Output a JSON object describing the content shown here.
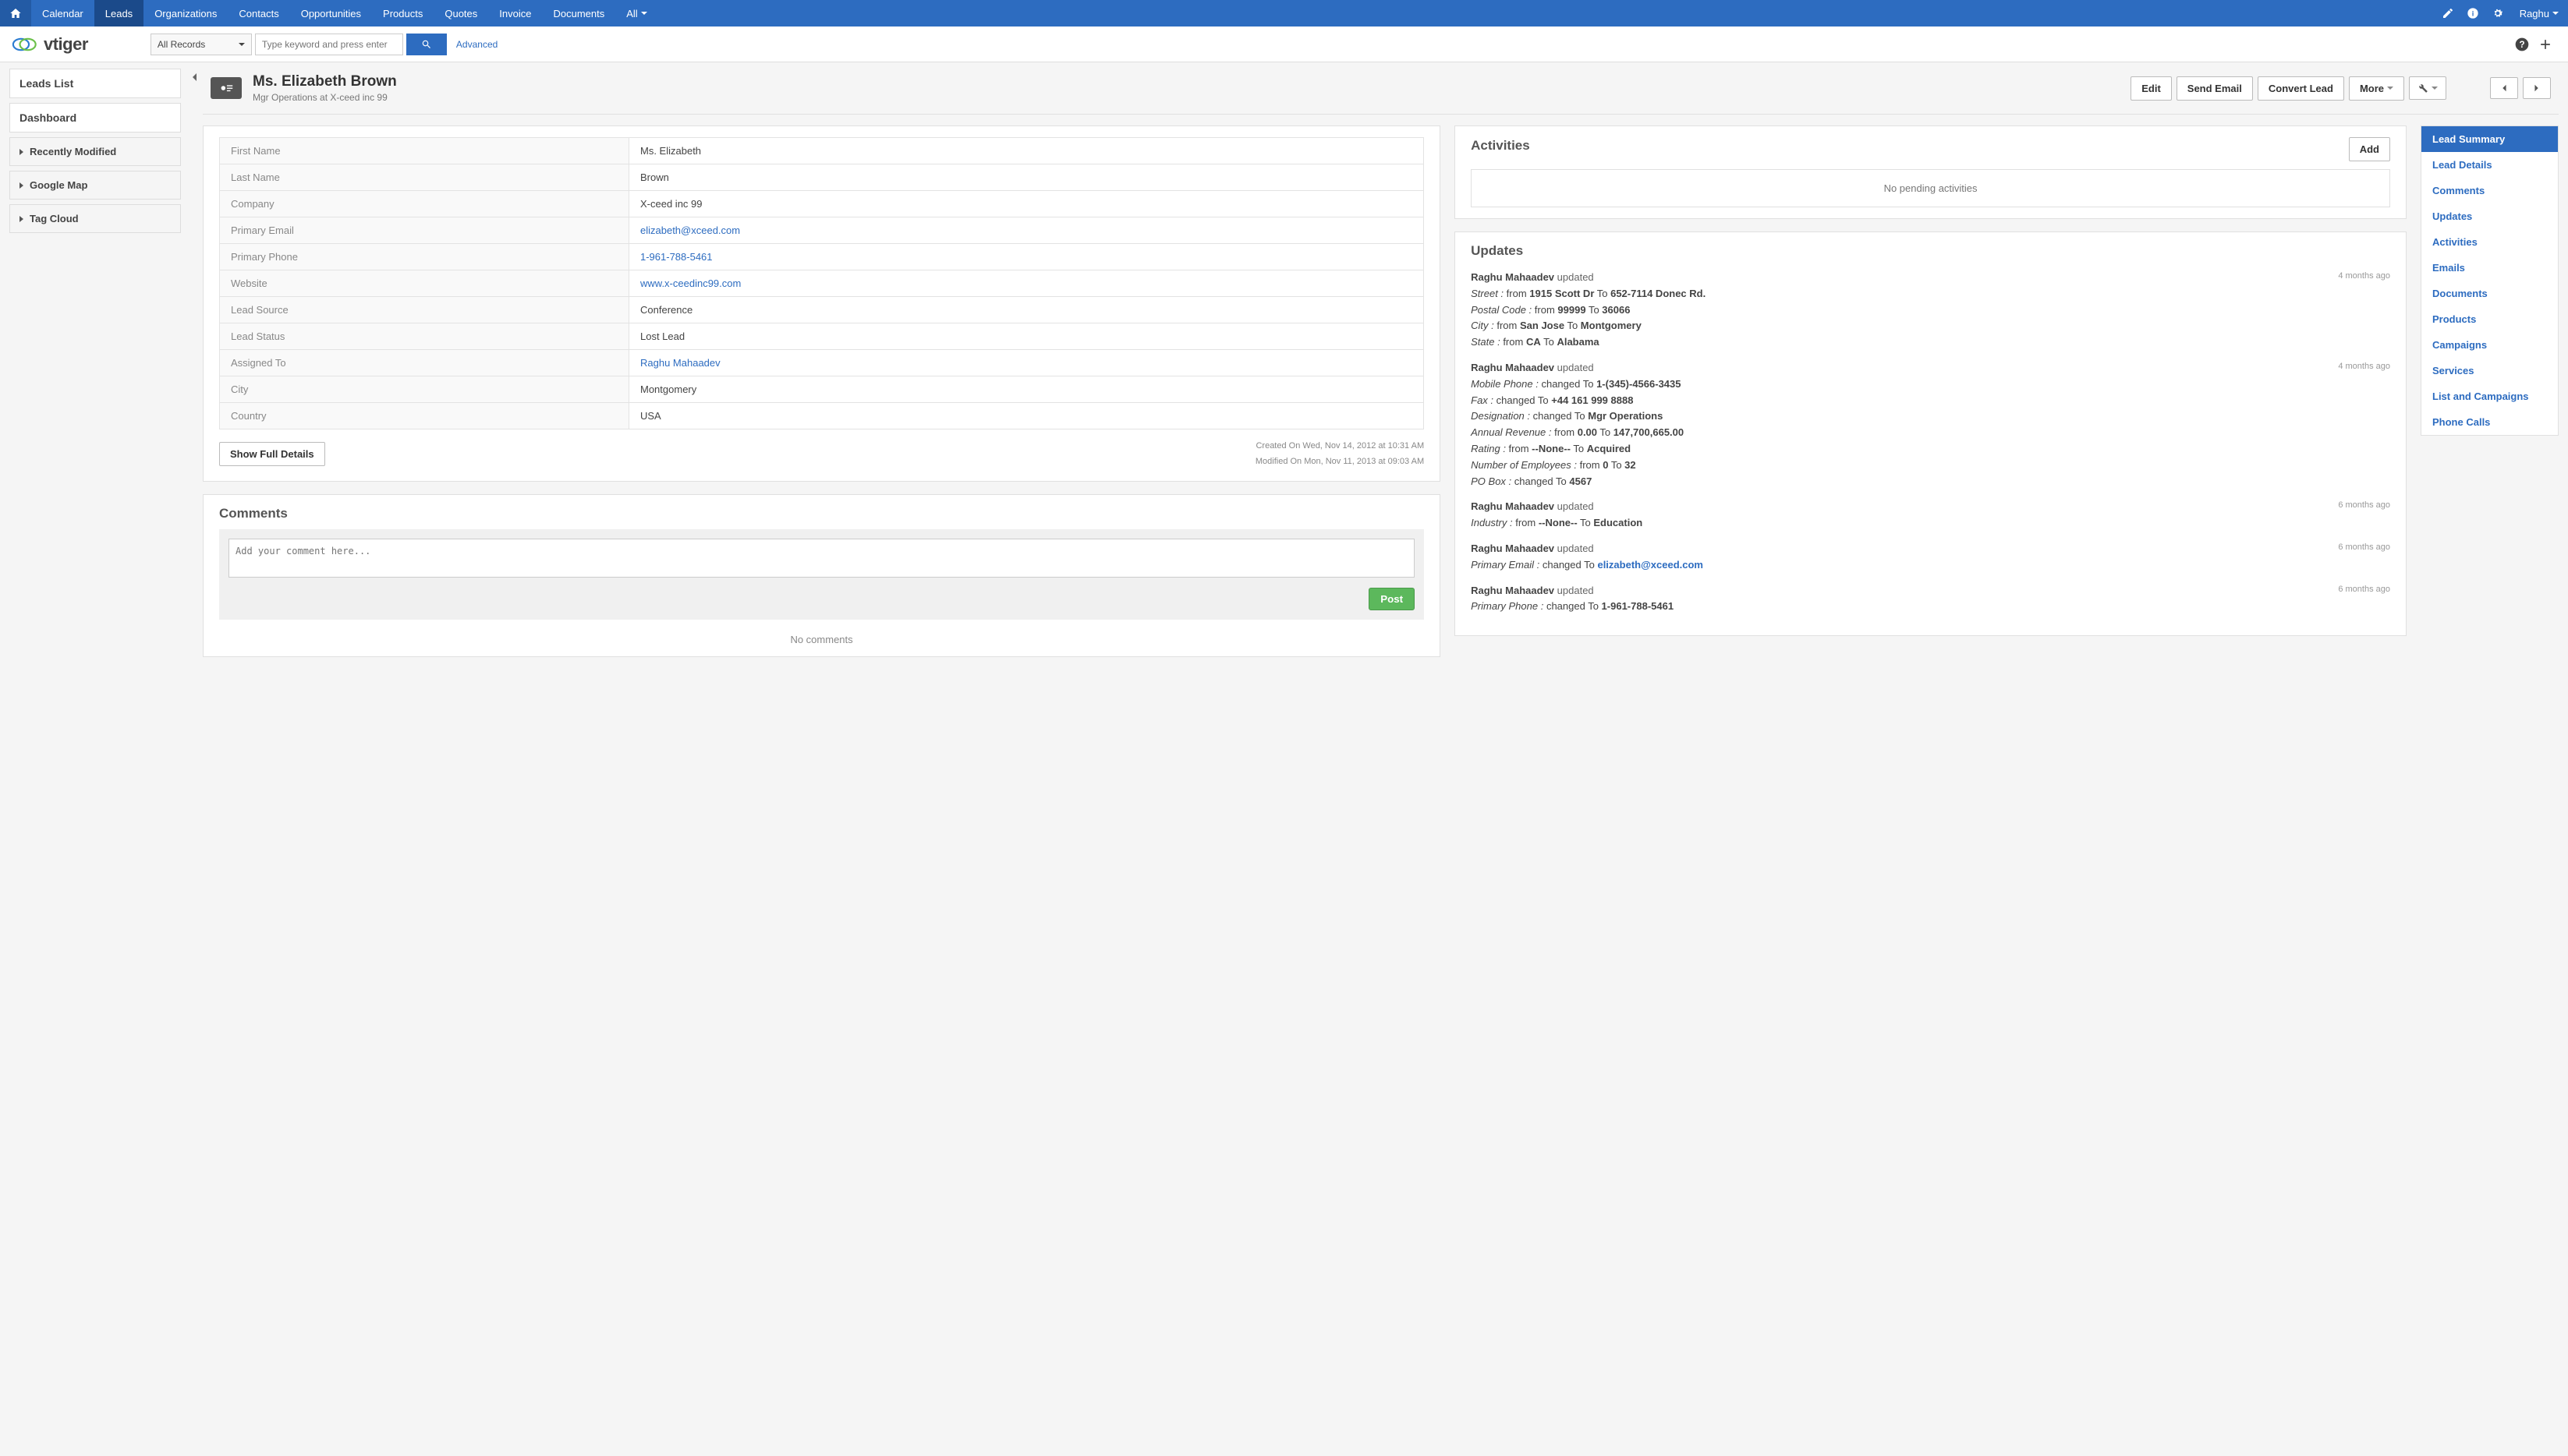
{
  "topnav": {
    "items": [
      "Calendar",
      "Leads",
      "Organizations",
      "Contacts",
      "Opportunities",
      "Products",
      "Quotes",
      "Invoice",
      "Documents",
      "All"
    ],
    "active_index": 1,
    "user": "Raghu"
  },
  "search": {
    "records_scope": "All Records",
    "placeholder": "Type keyword and press enter",
    "advanced": "Advanced"
  },
  "sidebar": {
    "items": [
      {
        "label": "Leads List",
        "type": "link"
      },
      {
        "label": "Dashboard",
        "type": "link"
      },
      {
        "label": "Recently Modified",
        "type": "widget"
      },
      {
        "label": "Google Map",
        "type": "widget"
      },
      {
        "label": "Tag Cloud",
        "type": "widget"
      }
    ]
  },
  "header": {
    "title": "Ms. Elizabeth Brown",
    "subtitle": "Mgr Operations at X-ceed inc 99",
    "buttons": {
      "edit": "Edit",
      "send_email": "Send Email",
      "convert": "Convert Lead",
      "more": "More"
    }
  },
  "details": {
    "fields": [
      {
        "label": "First Name",
        "value": "Ms. Elizabeth",
        "link": false
      },
      {
        "label": "Last Name",
        "value": "Brown",
        "link": false
      },
      {
        "label": "Company",
        "value": "X-ceed inc 99",
        "link": false
      },
      {
        "label": "Primary Email",
        "value": "elizabeth@xceed.com",
        "link": true
      },
      {
        "label": "Primary Phone",
        "value": "1-961-788-5461",
        "link": true
      },
      {
        "label": "Website",
        "value": "www.x-ceedinc99.com",
        "link": true
      },
      {
        "label": "Lead Source",
        "value": "Conference",
        "link": false
      },
      {
        "label": "Lead Status",
        "value": "Lost Lead",
        "link": false
      },
      {
        "label": "Assigned To",
        "value": "Raghu Mahaadev",
        "link": true
      },
      {
        "label": "City",
        "value": "Montgomery",
        "link": false
      },
      {
        "label": "Country",
        "value": "USA",
        "link": false
      }
    ],
    "show_full": "Show Full Details",
    "created": "Created On Wed, Nov 14, 2012 at 10:31 AM",
    "modified": "Modified On Mon, Nov 11, 2013 at 09:03 AM"
  },
  "comments": {
    "title": "Comments",
    "placeholder": "Add your comment here...",
    "post": "Post",
    "empty": "No comments"
  },
  "activities": {
    "title": "Activities",
    "add": "Add",
    "empty": "No pending activities"
  },
  "updates": {
    "title": "Updates",
    "entries": [
      {
        "who": "Raghu Mahaadev",
        "time": "4 months ago",
        "changes": [
          {
            "field": "Street",
            "text": "from",
            "old": "1915 Scott Dr",
            "mid": "To",
            "new": "652-7114 Donec Rd."
          },
          {
            "field": "Postal Code",
            "text": "from",
            "old": "99999",
            "mid": "To",
            "new": "36066"
          },
          {
            "field": "City",
            "text": "from",
            "old": "San Jose",
            "mid": "To",
            "new": "Montgomery"
          },
          {
            "field": "State",
            "text": "from",
            "old": "CA",
            "mid": "To",
            "new": "Alabama"
          }
        ]
      },
      {
        "who": "Raghu Mahaadev",
        "time": "4 months ago",
        "changes": [
          {
            "field": "Mobile Phone",
            "text": "changed To",
            "new": "1-(345)-4566-3435"
          },
          {
            "field": "Fax",
            "text": "changed To",
            "new": "+44 161 999 8888"
          },
          {
            "field": "Designation",
            "text": "changed To",
            "new": "Mgr Operations"
          },
          {
            "field": "Annual Revenue",
            "text": "from",
            "old": "0.00",
            "mid": "To",
            "new": "147,700,665.00"
          },
          {
            "field": "Rating",
            "text": "from",
            "old": "--None--",
            "mid": "To",
            "new": "Acquired"
          },
          {
            "field": "Number of Employees",
            "text": "from",
            "old": "0",
            "mid": "To",
            "new": "32"
          },
          {
            "field": "PO Box",
            "text": "changed To",
            "new": "4567"
          }
        ]
      },
      {
        "who": "Raghu Mahaadev",
        "time": "6 months ago",
        "changes": [
          {
            "field": "Industry",
            "text": "from",
            "old": "--None--",
            "mid": "To",
            "new": "Education"
          }
        ]
      },
      {
        "who": "Raghu Mahaadev",
        "time": "6 months ago",
        "changes": [
          {
            "field": "Primary Email",
            "text": "changed To",
            "new": "elizabeth@xceed.com",
            "link": true
          }
        ]
      },
      {
        "who": "Raghu Mahaadev",
        "time": "6 months ago",
        "changes": [
          {
            "field": "Primary Phone",
            "text": "changed To",
            "new": "1-961-788-5461"
          }
        ]
      }
    ]
  },
  "related": {
    "items": [
      "Lead Summary",
      "Lead Details",
      "Comments",
      "Updates",
      "Activities",
      "Emails",
      "Documents",
      "Products",
      "Campaigns",
      "Services",
      "List and Campaigns",
      "Phone Calls"
    ],
    "active_index": 0
  }
}
